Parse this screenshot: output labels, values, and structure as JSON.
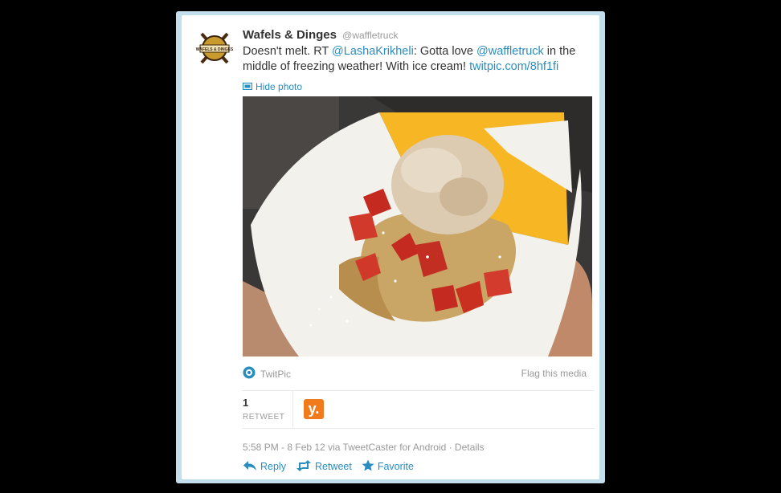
{
  "tweet": {
    "author_name": "Wafels & Dinges",
    "author_handle": "@waffletruck",
    "text_parts": {
      "p1": "Doesn't melt. RT ",
      "mention1": "@LashaKrikheli",
      "p2": ": Gotta love ",
      "mention2": "@waffletruck",
      "p3": " in the middle of freezing weather! With ice cream! ",
      "link": "twitpic.com/8hf1fi"
    },
    "hide_photo_label": "Hide photo",
    "media_provider": "TwitPic",
    "flag_label": "Flag this media",
    "retweet_count": "1",
    "retweet_label": "RETWEET",
    "retweeter_initial": "y.",
    "timestamp": "5:58 PM - 8 Feb 12",
    "via_text": " via TweetCaster for Android · ",
    "details_label": "Details",
    "actions": {
      "reply": "Reply",
      "retweet": "Retweet",
      "favorite": "Favorite"
    },
    "avatar_text": "WAFELS & DINGES"
  },
  "colors": {
    "link": "#2a8dc0",
    "frame": "#c3dfee",
    "retweeter_bg": "#f17a1c"
  },
  "icons": {
    "hide_photo": "photo-icon",
    "provider": "twitpic-icon",
    "reply": "reply-icon",
    "retweet": "retweet-icon",
    "favorite": "star-icon"
  }
}
